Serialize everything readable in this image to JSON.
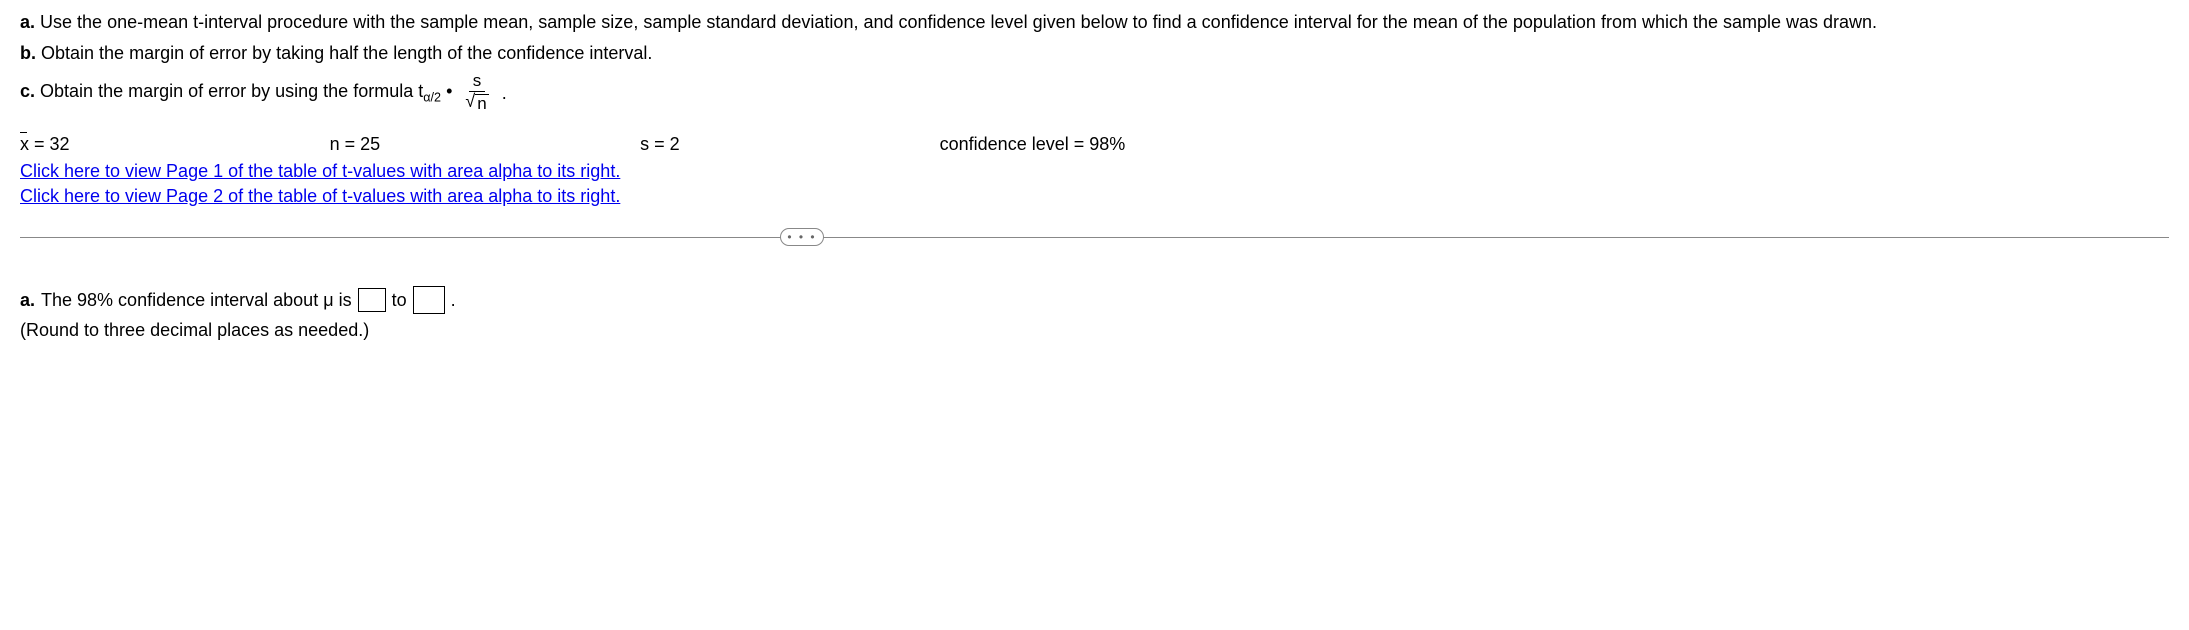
{
  "parts": {
    "a": {
      "label": "a.",
      "text": "Use the one-mean t-interval procedure with the sample mean, sample size, sample standard deviation, and confidence level given below to find a confidence interval for the mean of the population from which the sample was drawn."
    },
    "b": {
      "label": "b.",
      "text": "Obtain the margin of error by taking half the length of the confidence interval."
    },
    "c": {
      "label": "c.",
      "text": "Obtain the margin of error by using the formula"
    }
  },
  "formula": {
    "tsub": "α/2",
    "num": "s",
    "den_sym": "√",
    "den_var": "n"
  },
  "given": {
    "xbar": {
      "label": "x",
      "equals": "= 32"
    },
    "n": "n = 25",
    "s": "s = 2",
    "conf": "confidence level = 98%"
  },
  "links": {
    "page1": "Click here to view Page 1 of the table of t-values with area alpha to its right.",
    "page2": "Click here to view Page 2 of the table of t-values with area alpha to its right."
  },
  "expander": "• • •",
  "answer": {
    "label": "a.",
    "pre": "The 98% confidence interval about μ is",
    "mid": "to",
    "post": ".",
    "note": "(Round to three decimal places as needed.)"
  }
}
